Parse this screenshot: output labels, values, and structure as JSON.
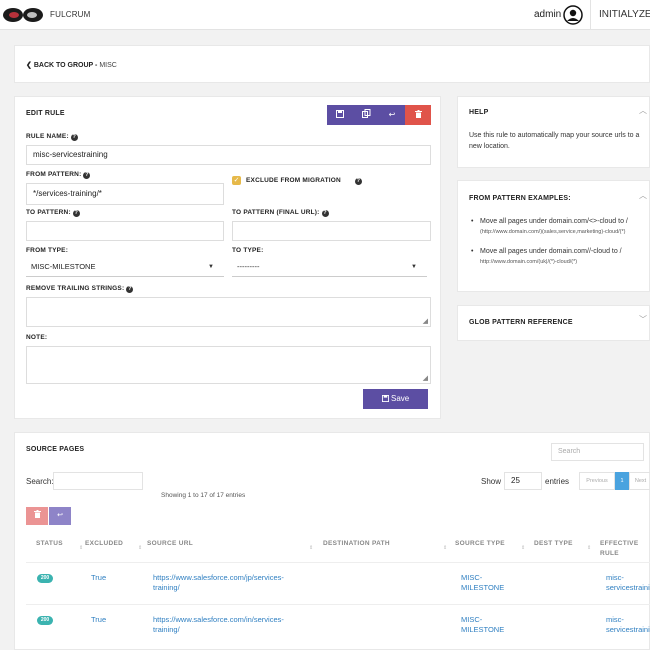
{
  "app": {
    "name": "FULCRUM",
    "user": "admin",
    "initialize_label": "INITIALYZE"
  },
  "breadcrumb": {
    "back_label": "BACK TO GROUP -",
    "group": "MISC"
  },
  "edit_rule": {
    "title": "EDIT RULE",
    "toolbar": [
      "save-icon",
      "copy-icon",
      "revert-icon",
      "trash-icon"
    ],
    "rule_name_label": "RULE NAME:",
    "rule_name_value": "misc-servicestraining",
    "from_pattern_label": "FROM PATTERN:",
    "from_pattern_value": "*/services-training/*",
    "exclude_label": "EXCLUDE FROM MIGRATION",
    "exclude_checked": true,
    "to_pattern_label": "TO PATTERN:",
    "to_pattern_value": "",
    "to_pattern_final_label": "TO PATTERN (FINAL URL):",
    "to_pattern_final_value": "",
    "from_type_label": "FROM TYPE:",
    "from_type_value": "MISC-MILESTONE",
    "to_type_label": "TO TYPE:",
    "to_type_value": "---------",
    "remove_trailing_label": "REMOVE TRAILING STRINGS:",
    "note_label": "NOTE:",
    "save_label": "Save"
  },
  "help": {
    "title": "HELP",
    "text": "Use this rule to automatically map your source urls to a new location."
  },
  "from_pattern_examples": {
    "title": "FROM PATTERN EXAMPLES:",
    "items": [
      {
        "text": "Move all pages under domain.com/<>-cloud to /",
        "detail": "(http://www.domain.com/)(sales,service,marketing)-cloud/(*)"
      },
      {
        "text": "Move all pages under domain.com//-cloud to /",
        "detail": "http://www.domain.com/(uk|/(*)-cloud/(*)"
      }
    ]
  },
  "glob_reference": {
    "title": "GLOB PATTERN REFERENCE"
  },
  "source_pages": {
    "title": "SOURCE PAGES",
    "top_search_placeholder": "Search",
    "search_label": "Search:",
    "showing": "Showing 1 to 17 of 17 entries",
    "show_label": "Show",
    "page_size": "25",
    "entries_label": "entries",
    "pager": {
      "previous": "Previous",
      "current": "1",
      "next": "Next"
    },
    "columns": [
      "STATUS",
      "EXCLUDED",
      "SOURCE URL",
      "DESTINATION PATH",
      "SOURCE TYPE",
      "DEST TYPE",
      "EFFECTIVE RULE"
    ],
    "rows": [
      {
        "status": "200",
        "excluded": "True",
        "url_1": "https://www.salesforce.com/jp/services-",
        "url_2": "training/",
        "dest": "",
        "type_1": "MISC-",
        "type_2": "MILESTONE",
        "dest_type": "",
        "rule_1": "misc-",
        "rule_2": "servicestraining"
      },
      {
        "status": "200",
        "excluded": "True",
        "url_1": "https://www.salesforce.com/in/services-",
        "url_2": "training/",
        "dest": "",
        "type_1": "MISC-",
        "type_2": "MILESTONE",
        "dest_type": "",
        "rule_1": "misc-",
        "rule_2": "servicestraining"
      }
    ]
  },
  "colors": {
    "accent": "#5c4ea3",
    "danger": "#e0544a",
    "status": "#3bb3b0",
    "link": "#2f7fc1",
    "checkbox": "#e6b94a"
  }
}
